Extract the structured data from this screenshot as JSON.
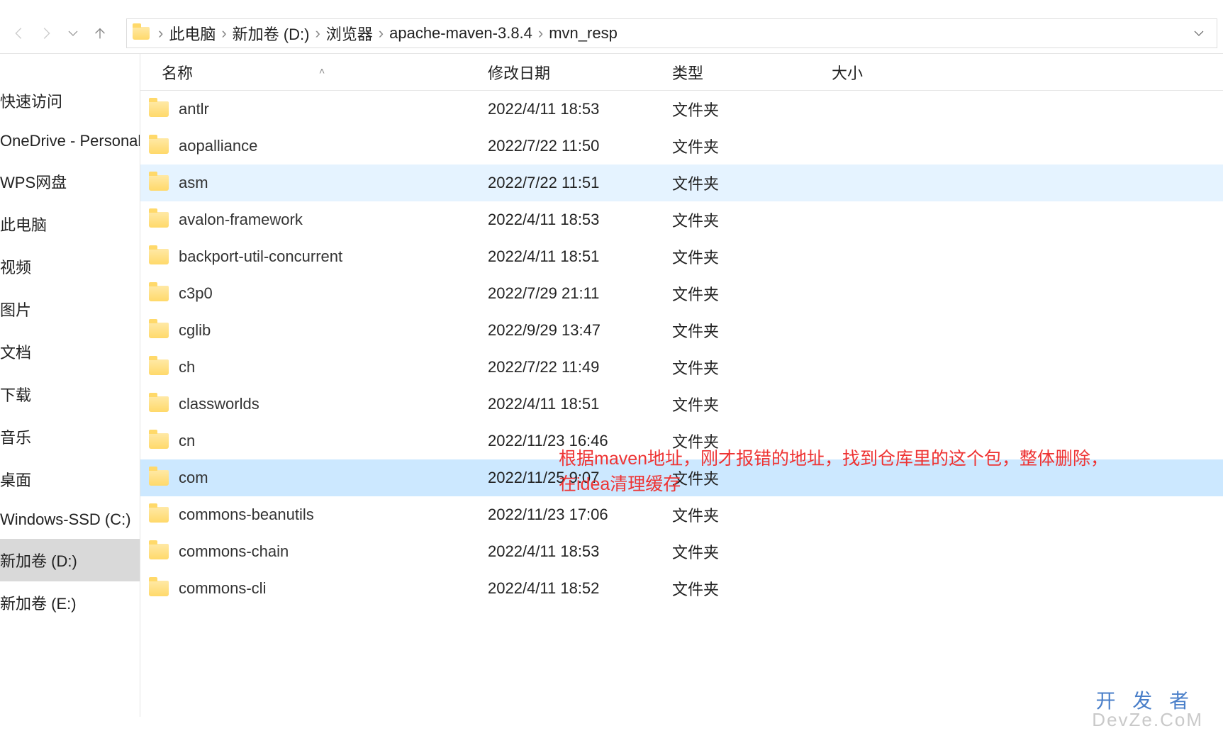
{
  "breadcrumb": [
    "此电脑",
    "新加卷 (D:)",
    "浏览器",
    "apache-maven-3.8.4",
    "mvn_resp"
  ],
  "sidebar": {
    "items": [
      {
        "label": "快速访问"
      },
      {
        "label": "OneDrive - Personal"
      },
      {
        "label": "WPS网盘"
      },
      {
        "label": "此电脑"
      },
      {
        "label": "视频"
      },
      {
        "label": "图片"
      },
      {
        "label": "文档"
      },
      {
        "label": "下载"
      },
      {
        "label": "音乐"
      },
      {
        "label": "桌面"
      },
      {
        "label": "Windows-SSD (C:)"
      },
      {
        "label": "新加卷 (D:)",
        "selected": true
      },
      {
        "label": "新加卷 (E:)"
      }
    ]
  },
  "columns": {
    "name": "名称",
    "date": "修改日期",
    "type": "类型",
    "size": "大小"
  },
  "type_folder": "文件夹",
  "rows": [
    {
      "name": "antlr",
      "date": "2022/4/11 18:53"
    },
    {
      "name": "aopalliance",
      "date": "2022/7/22 11:50"
    },
    {
      "name": "asm",
      "date": "2022/7/22 11:51",
      "hover": true
    },
    {
      "name": "avalon-framework",
      "date": "2022/4/11 18:53"
    },
    {
      "name": "backport-util-concurrent",
      "date": "2022/4/11 18:51"
    },
    {
      "name": "c3p0",
      "date": "2022/7/29 21:11"
    },
    {
      "name": "cglib",
      "date": "2022/9/29 13:47"
    },
    {
      "name": "ch",
      "date": "2022/7/22 11:49"
    },
    {
      "name": "classworlds",
      "date": "2022/4/11 18:51"
    },
    {
      "name": "cn",
      "date": "2022/11/23 16:46"
    },
    {
      "name": "com",
      "date": "2022/11/25 9:07",
      "selected": true
    },
    {
      "name": "commons-beanutils",
      "date": "2022/11/23 17:06"
    },
    {
      "name": "commons-chain",
      "date": "2022/4/11 18:53"
    },
    {
      "name": "commons-cli",
      "date": "2022/4/11 18:52"
    }
  ],
  "annotation": {
    "line1": "根据maven地址，刚才报错的地址，找到仓库里的这个包，整体删除，",
    "line2": "在idea清理缓存"
  },
  "watermark": {
    "top": "开 发 者",
    "bottom": "DevZe.CoM"
  }
}
